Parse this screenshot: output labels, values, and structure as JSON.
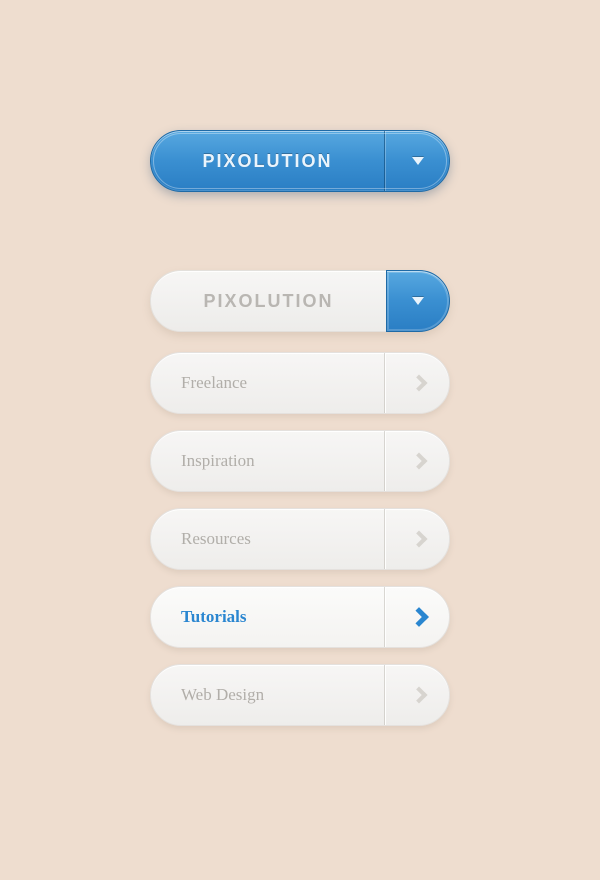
{
  "colors": {
    "accent": "#348ccd",
    "text_muted": "#b1aea9",
    "background": "#eeddcf"
  },
  "dropdown": {
    "closed_label": "PIXOLUTION",
    "open_label": "PIXOLUTION"
  },
  "menu": {
    "items": [
      {
        "label": "Freelance",
        "active": false
      },
      {
        "label": "Inspiration",
        "active": false
      },
      {
        "label": "Resources",
        "active": false
      },
      {
        "label": "Tutorials",
        "active": true
      },
      {
        "label": "Web Design",
        "active": false
      }
    ]
  }
}
